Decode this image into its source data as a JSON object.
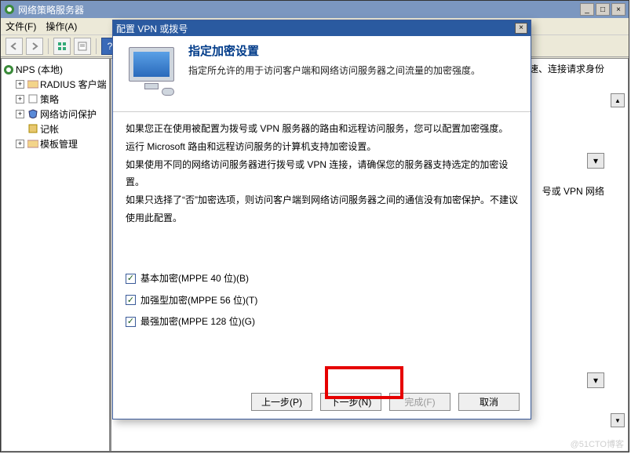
{
  "mainWindow": {
    "title": "网络策略服务器",
    "minimize": "_",
    "maximize": "□",
    "close": "×"
  },
  "menu": {
    "file": "文件(F)",
    "action": "操作(A)"
  },
  "tree": {
    "root": "NPS (本地)",
    "items": [
      "RADIUS 客户端",
      "策略",
      "网络访问保护",
      "记帐",
      "模板管理"
    ]
  },
  "contentPane": {
    "rightText": "速、连接请求身份",
    "midText": "号或 VPN 网络"
  },
  "dialog": {
    "title": "配置 VPN 或拨号",
    "close": "×",
    "heading": "指定加密设置",
    "subheading": "指定所允许的用于访问客户端和网络访问服务器之间流量的加密强度。",
    "body": {
      "p1": "如果您正在使用被配置为拨号或 VPN 服务器的路由和远程访问服务，您可以配置加密强度。",
      "p2": "运行 Microsoft 路由和远程访问服务的计算机支持加密设置。",
      "p3": "如果使用不同的网络访问服务器进行拨号或 VPN 连接，请确保您的服务器支持选定的加密设置。",
      "p4": "如果只选择了“否”加密选项，则访问客户端到网络访问服务器之间的通信没有加密保护。不建议使用此配置。"
    },
    "checks": {
      "c1": "基本加密(MPPE 40 位)(B)",
      "c2": "加强型加密(MPPE 56 位)(T)",
      "c3": "最强加密(MPPE 128 位)(G)"
    },
    "buttons": {
      "back": "上一步(P)",
      "next": "下一步(N)",
      "finish": "完成(F)",
      "cancel": "取消"
    }
  },
  "watermark": "@51CTO博客"
}
